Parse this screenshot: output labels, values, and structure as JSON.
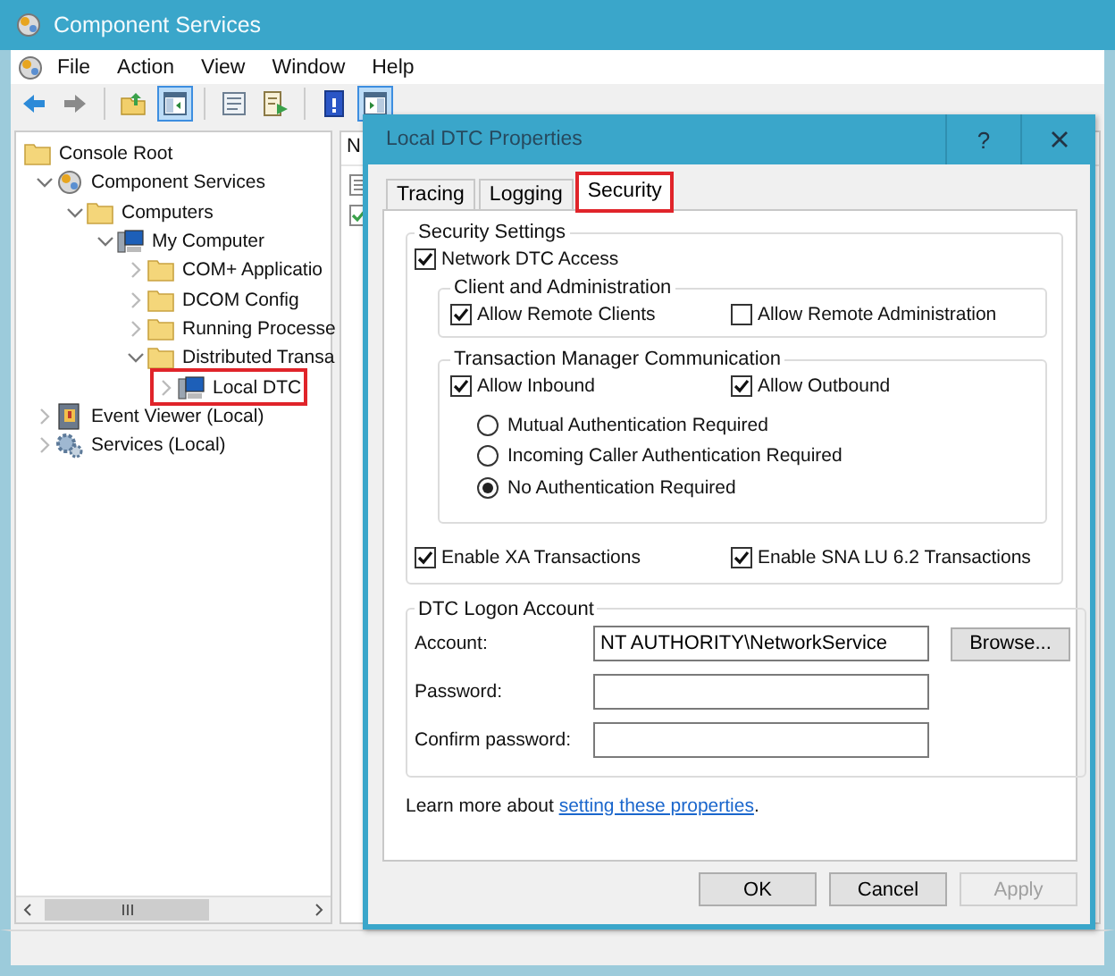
{
  "window": {
    "title": "Component Services"
  },
  "menu": [
    "File",
    "Action",
    "View",
    "Window",
    "Help"
  ],
  "toolbar": [
    [
      {
        "kind": "back",
        "on": false
      },
      {
        "kind": "forward",
        "on": false
      }
    ],
    [
      {
        "kind": "up",
        "on": false
      },
      {
        "kind": "tree_toggle",
        "on": true
      }
    ],
    [
      {
        "kind": "properties",
        "on": false
      },
      {
        "kind": "export",
        "on": false
      }
    ],
    [
      {
        "kind": "help",
        "on": false
      },
      {
        "kind": "action_pane",
        "on": true
      }
    ]
  ],
  "tree": [
    {
      "label": "Console Root",
      "kind": "folder",
      "children": [
        {
          "label": "Component Services",
          "kind": "snapin",
          "expanded": true,
          "children": [
            {
              "label": "Computers",
              "kind": "folder",
              "expanded": true,
              "children": [
                {
                  "label": "My Computer",
                  "kind": "computer",
                  "expanded": true,
                  "children": [
                    {
                      "label": "COM+ Applicatio",
                      "kind": "folder",
                      "expanded": false
                    },
                    {
                      "label": "DCOM Config",
                      "kind": "folder",
                      "expanded": false
                    },
                    {
                      "label": "Running Processe",
                      "kind": "folder",
                      "expanded": false
                    },
                    {
                      "label": "Distributed Transa",
                      "kind": "folder",
                      "expanded": true,
                      "children": [
                        {
                          "label": "Local DTC",
                          "kind": "computer",
                          "expanded": false,
                          "highlighted": true
                        }
                      ]
                    }
                  ]
                }
              ]
            }
          ]
        },
        {
          "label": "Event Viewer (Local)",
          "kind": "log",
          "expanded": false
        },
        {
          "label": "Services (Local)",
          "kind": "gear",
          "expanded": false
        }
      ]
    }
  ],
  "list_pane": {
    "columns": [
      "N"
    ]
  },
  "dialog": {
    "title": "Local DTC Properties",
    "help_button": "?",
    "tabs": [
      {
        "label": "Tracing",
        "selected": false,
        "highlighted": false
      },
      {
        "label": "Logging",
        "selected": false,
        "highlighted": false
      },
      {
        "label": "Security",
        "selected": true,
        "highlighted": true
      }
    ],
    "security_settings": {
      "legend": "Security Settings",
      "network_dtc_access": {
        "label": "Network DTC Access",
        "checked": true
      },
      "client_admin": {
        "legend": "Client and Administration",
        "options": [
          {
            "label": "Allow Remote Clients",
            "checked": true
          },
          {
            "label": "Allow Remote Administration",
            "checked": false
          }
        ]
      },
      "tm_communication": {
        "legend": "Transaction Manager Communication",
        "options": [
          {
            "label": "Allow Inbound",
            "checked": true
          },
          {
            "label": "Allow Outbound",
            "checked": true
          }
        ],
        "authentication": [
          {
            "label": "Mutual Authentication Required",
            "selected": false
          },
          {
            "label": "Incoming Caller Authentication Required",
            "selected": false
          },
          {
            "label": "No Authentication Required",
            "selected": true
          }
        ]
      },
      "transactions": [
        {
          "label": "Enable XA Transactions",
          "checked": true
        },
        {
          "label": "Enable SNA LU 6.2 Transactions",
          "checked": true
        }
      ]
    },
    "logon_account": {
      "legend": "DTC Logon Account",
      "fields": [
        {
          "label": "Account:",
          "value": "NT AUTHORITY\\NetworkService"
        },
        {
          "label": "Password:"
        },
        {
          "label": "Confirm password:"
        }
      ],
      "browse_button": "Browse..."
    },
    "learn_more": {
      "text": "Learn more about ",
      "link": "setting these properties",
      "after": "."
    },
    "buttons": [
      {
        "label": "OK",
        "disabled": false
      },
      {
        "label": "Cancel",
        "disabled": false
      },
      {
        "label": "Apply",
        "disabled": true
      }
    ]
  }
}
